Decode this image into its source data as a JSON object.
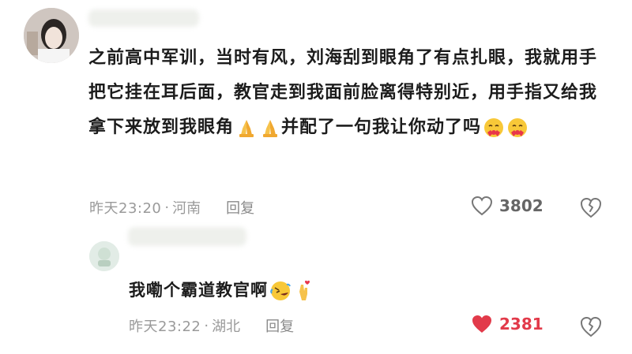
{
  "comment": {
    "text": "之前高中军训，当时有风，刘海刮到眼角了有点扎眼，我就用手把它挂在耳后面，教官走到我面前脸离得特别近，用手指又给我拿下来放到我眼角",
    "text_tail": "并配了一句我让你动了吗",
    "time": "昨天23:20",
    "separator": "·",
    "location": "河南",
    "reply_label": "回复",
    "like_count": "3802",
    "emojis_1": [
      "folded-hands",
      "folded-hands"
    ],
    "emojis_2": [
      "smiling-face-with-hearts",
      "smiling-face-with-hearts"
    ]
  },
  "reply": {
    "text": "我嘞个霸道教官啊",
    "time": "昨天23:22",
    "separator": "·",
    "location": "湖北",
    "reply_label": "回复",
    "like_count": "2381",
    "liked": true,
    "emojis": [
      "rolling-laughing",
      "crossed-fingers-heart"
    ]
  },
  "colors": {
    "liked_red": "#e23a4a",
    "meta_gray": "#9a9a9a"
  }
}
